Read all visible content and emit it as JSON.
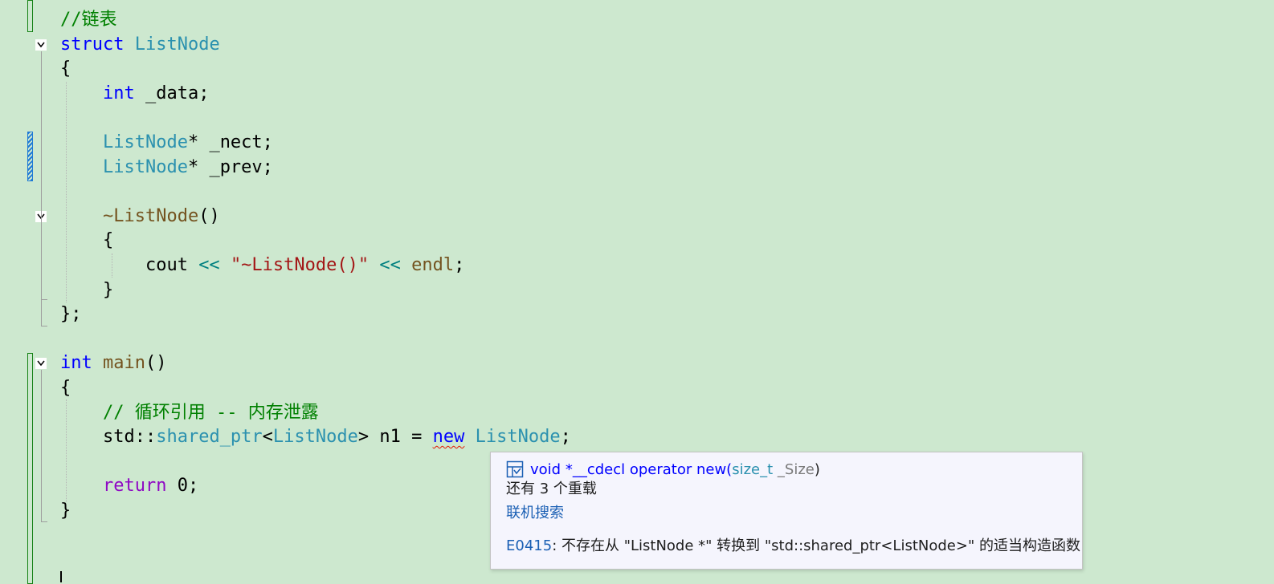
{
  "editor": {
    "lines": [
      {
        "id": "l1",
        "tokens": [
          {
            "t": "//链表",
            "c": "cmt"
          }
        ]
      },
      {
        "id": "l2",
        "tokens": [
          {
            "t": "struct",
            "c": "kw"
          },
          {
            "t": " "
          },
          {
            "t": "ListNode",
            "c": "type"
          }
        ]
      },
      {
        "id": "l3",
        "tokens": [
          {
            "t": "{"
          }
        ]
      },
      {
        "id": "l4",
        "tokens": [
          {
            "t": "    "
          },
          {
            "t": "int",
            "c": "kw"
          },
          {
            "t": " _data;"
          }
        ]
      },
      {
        "id": "l5",
        "tokens": []
      },
      {
        "id": "l6",
        "tokens": [
          {
            "t": "    "
          },
          {
            "t": "ListNode",
            "c": "type"
          },
          {
            "t": "* _nect;"
          }
        ]
      },
      {
        "id": "l7",
        "tokens": [
          {
            "t": "    "
          },
          {
            "t": "ListNode",
            "c": "type"
          },
          {
            "t": "* _prev;"
          }
        ]
      },
      {
        "id": "l8",
        "tokens": []
      },
      {
        "id": "l9",
        "tokens": [
          {
            "t": "    "
          },
          {
            "t": "~ListNode",
            "c": "fn"
          },
          {
            "t": "()"
          }
        ]
      },
      {
        "id": "l10",
        "tokens": [
          {
            "t": "    {"
          }
        ]
      },
      {
        "id": "l11",
        "tokens": [
          {
            "t": "        cout "
          },
          {
            "t": "<<",
            "c": "op"
          },
          {
            "t": " "
          },
          {
            "t": "\"~ListNode()\"",
            "c": "str"
          },
          {
            "t": " "
          },
          {
            "t": "<<",
            "c": "op"
          },
          {
            "t": " "
          },
          {
            "t": "endl",
            "c": "fn"
          },
          {
            "t": ";"
          }
        ]
      },
      {
        "id": "l12",
        "tokens": [
          {
            "t": "    }"
          }
        ]
      },
      {
        "id": "l13",
        "tokens": [
          {
            "t": "};"
          }
        ]
      },
      {
        "id": "l14",
        "tokens": []
      },
      {
        "id": "l15",
        "tokens": [
          {
            "t": "int",
            "c": "kw"
          },
          {
            "t": " "
          },
          {
            "t": "main",
            "c": "fn"
          },
          {
            "t": "()"
          }
        ]
      },
      {
        "id": "l16",
        "tokens": [
          {
            "t": "{"
          }
        ]
      },
      {
        "id": "l17",
        "tokens": [
          {
            "t": "    "
          },
          {
            "t": "// 循环引用 -- 内存泄露",
            "c": "cmt"
          }
        ]
      },
      {
        "id": "l18",
        "tokens": [
          {
            "t": "    std::"
          },
          {
            "t": "shared_ptr",
            "c": "type"
          },
          {
            "t": "<"
          },
          {
            "t": "ListNode",
            "c": "type"
          },
          {
            "t": "> n1 = "
          },
          {
            "t": "new",
            "c": "kw",
            "err": true
          },
          {
            "t": " "
          },
          {
            "t": "ListNode",
            "c": "type"
          },
          {
            "t": ";"
          }
        ]
      },
      {
        "id": "l19",
        "tokens": []
      },
      {
        "id": "l20",
        "tokens": [
          {
            "t": "    "
          },
          {
            "t": "return",
            "c": "kwp"
          },
          {
            "t": " 0;"
          }
        ]
      },
      {
        "id": "l21",
        "tokens": [
          {
            "t": "}"
          }
        ]
      }
    ]
  },
  "tooltip": {
    "icon": "function-icon",
    "signature": {
      "return_kw": "void",
      "rest": " *__cdecl operator new(",
      "param_type": "size_t",
      "param_name": " _Size",
      "close": ")"
    },
    "overloads": "还有 3 个重载",
    "online_search": "联机搜索",
    "error_code": "E0415",
    "error_text": ": 不存在从 \"ListNode *\" 转换到 \"std::shared_ptr<ListNode>\" 的适当构造函数"
  }
}
